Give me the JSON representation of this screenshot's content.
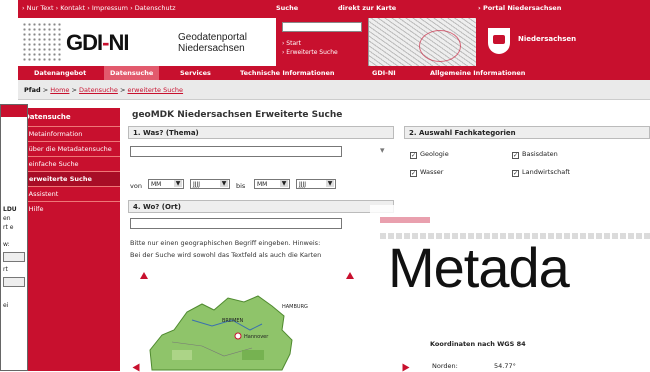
{
  "topbar": {
    "links": "› Nur Text  › Kontakt  › Impressum  › Datenschutz",
    "suche": "Suche",
    "karte": "direkt zur Karte",
    "portal": "› Portal Niedersachsen"
  },
  "header": {
    "logo": "GDI-NI",
    "subtitle_line1": "Geodatenportal",
    "subtitle_line2": "Niedersachsen",
    "start_link": "› Start",
    "advanced_link": "› Erweiterte Suche",
    "state_name": "Niedersachsen"
  },
  "nav": {
    "items": [
      "Datenangebot",
      "Datensuche",
      "Services",
      "Technische Informationen",
      "GDI-NI",
      "Allgemeine Informationen"
    ],
    "active": "Datensuche"
  },
  "path": {
    "label": "Pfad",
    "crumbs": [
      "Home",
      "Datensuche",
      "erweiterte Suche"
    ]
  },
  "sidebar": {
    "title": "Datensuche",
    "items": [
      "› Metainformation",
      "› über die Metadatensuche",
      "› einfache Suche",
      "› erweiterte Suche",
      "› Assistent",
      "› Hilfe"
    ]
  },
  "left_window": {
    "texts": [
      "LDU",
      "en",
      "rt e",
      "w:",
      "rt",
      "ei"
    ]
  },
  "main": {
    "title": "geoMDK Niedersachsen Erweiterte Suche",
    "section1": "1. Was? (Thema)",
    "section2": "2. Auswahl Fachkategorien",
    "section4": "4. Wo? (Ort)",
    "von": "von",
    "bis": "bis",
    "month_placeholder": "MM",
    "year_placeholder": "JJJJ",
    "categories": [
      {
        "label": "Geologie",
        "checked": true
      },
      {
        "label": "Basisdaten",
        "checked": true
      },
      {
        "label": "Wasser",
        "checked": true
      },
      {
        "label": "Landwirtschaft",
        "checked": true
      }
    ],
    "instructions_line1": "Bitte nur einen geographischen Begriff eingeben. Hinweis:",
    "instructions_line2": "Bei der Suche wird sowohl das Textfeld als auch die Karten"
  },
  "map": {
    "labels": [
      "HAMBURG",
      "BREMEN",
      "Hannover"
    ]
  },
  "overlay": {
    "big_word": "Metada"
  },
  "coordinates": {
    "title": "Koordinaten nach WGS 84",
    "north_label": "Norden:",
    "north_value": "54.77°"
  },
  "colors": {
    "brand_red": "#c8102e",
    "map_green": "#8fc46a"
  }
}
